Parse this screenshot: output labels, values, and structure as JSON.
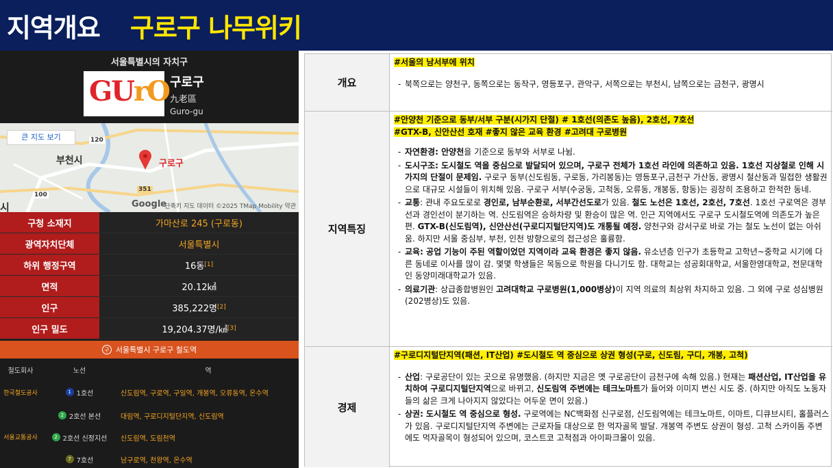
{
  "header": {
    "title_white": "지역개요",
    "title_yellow": "구로구 나무위키"
  },
  "wiki": {
    "caption": "서울특별시의 자치구",
    "emblem_gu": "GU",
    "emblem_ro": "rO",
    "name_ko": "구로구",
    "name_hanja": "九老區",
    "name_en": "Guro-gu",
    "map": {
      "button": "큰 지도 보기",
      "label_bucheon": "부천시",
      "label_guro": "구로구",
      "road_120": "120",
      "road_100": "100",
      "road_351": "351",
      "google": "Google",
      "credit": "단축키   지도 데이터 ©2025 TMap Mobility   약관",
      "label_edge": "시"
    },
    "info_rows": [
      {
        "key": "구청 소재지",
        "value": "가마산로 245 (구로동)",
        "sup": ""
      },
      {
        "key": "광역자치단체",
        "value": "서울특별시",
        "sup": ""
      },
      {
        "key": "하위 행정구역",
        "value": "16동",
        "sup": "[1]"
      },
      {
        "key": "면적",
        "value": "20.12㎢",
        "sup": ""
      },
      {
        "key": "인구",
        "value": "385,222명",
        "sup": "[2]"
      },
      {
        "key": "인구 밀도",
        "value": "19,204.37명/㎢",
        "sup": "[3]"
      }
    ],
    "rail": {
      "title": "서울특별시 구로구 철도역",
      "logo": "구",
      "cols": [
        "철도회사",
        "노선",
        "역"
      ],
      "operators": [
        "한국철도공사",
        "서울교통공사"
      ],
      "rows": [
        {
          "num": "1",
          "color": "#1a3fa0",
          "line": "1호선",
          "stations": "신도림역, 구로역, 구일역, 개봉역, 오류동역, 온수역"
        },
        {
          "num": "2",
          "color": "#2ea84a",
          "line": "2호선 본선",
          "stations": "대림역, 구로디지털단지역, 신도림역"
        },
        {
          "num": "2",
          "color": "#2ea84a",
          "line": "2호선 신정지선",
          "stations": "신도림역, 도림천역"
        },
        {
          "num": "7",
          "color": "#6b6b1f",
          "line": "7호선",
          "stations": "남구로역, 천왕역, 온수역"
        }
      ]
    }
  },
  "table": {
    "overview": {
      "key": "개요",
      "tag": "#서울의 남서부에 위치",
      "bullet": "북쪽으로는 양천구, 동쪽으로는 동작구, 영등포구, 관악구, 서쪽으로는 부천시, 남쪽으로는 금천구, 광명시"
    },
    "features": {
      "key": "지역특징",
      "tag1": "#안양천 기준으로 동부/서부 구분(시가지 단절) # 1호선(의존도 높음), 2호선, 7호선",
      "tag2": "#GTX-B, 신안산선 호재 #좋지 않은 교육 환경 #고려대 구로병원",
      "b1_bold": "자연환경: 안양천",
      "b1_rest": "을 기준으로 동부와 서부로 나뉨.",
      "b2_bold": "도시구조: 도시철도 역을 중심으로 발달되어 있으며, 구로구 전체가 1호선 라인에 의존하고 있음. 1호선 지상철로 인해 시가지의 단절이 문제임.",
      "b2_rest": " 구로구 동부(신도림동, 구로동, 가리봉동)는 영등포구,금천구 가산동, 광명시 철산동과 밀접한 생활권으로 대규모 시설들이 위치해 있음. 구로구 서부(수궁동, 고척동, 오류동, 개봉동, 항동)는 굉장히 조용하고 한적한 동네.",
      "b3_a": "교통",
      "b3_b": ": 관내 주요도로로 ",
      "b3_c": "경인로, 남부순환로, 서부간선도로",
      "b3_d": "가 있음. ",
      "b3_e": "철도 노선은 1호선, 2호선, 7호선",
      "b3_f": ". 1호선 구로역은 경부선과 경인선이 분기하는 역. 신도림역은 승하차량 및 환승이 많은 역. 인근 지역에서도 구로구 도시철도역에 의존도가 높은 편. ",
      "b3_g": "GTX-B(신도림역), 신안산선(구로디지털단지역)도 개통될 예정.",
      "b3_h": " 양천구와 강서구로 바로 가는 철도 노선이 없는 아쉬움. 하지만 서울 중심부, 부천, 인천 방향으로의 접근성은 훌륭함.",
      "b4_bold": "교육: 공업 기능이 주된 역할이었던 지역이라 교육 환경은 좋지 않음.",
      "b4_rest": " 유소년층 인구가 초등학교 고학년~중학교 시기에 다른 동네로 이사를 많이 감. 몇몇 학생들은 목동으로 학원을 다니기도 함. 대학교는 성공회대학교, 서울한영대학교, 전문대학인 동양미래대학교가 있음.",
      "b5_a": "의료기관",
      "b5_b": ": 상급종합병원인 ",
      "b5_c": "고려대학교 구로병원(1,000병상)",
      "b5_d": "이 지역 의료의 최상위 차지하고 있음. 그 외에 구로 성심병원(202병상)도 있음."
    },
    "economy": {
      "key": "경제",
      "tag": "#구로디지털단지역(패션, IT산업) #도시철도 역 중심으로 상권 형성(구로, 신도림, 구디, 개봉, 고척)",
      "b1_a": "산업",
      "b1_b": ": 구로공단이 있는 곳으로 유명했음. (하지만 지금은 옛 구로공단이 금천구에 속해 있음.) 현재는 ",
      "b1_c": "패션산업, IT산업을 유치하여 구로디지털단지역",
      "b1_d": "으로 바뀌고, ",
      "b1_e": "신도림역 주변에는 테크노마트",
      "b1_f": "가 들어와 이미지 변신 시도 중. (하지만 아직도 노동자들의 삶은 크게 나아지지 않았다는 어두운 면이 있음.)",
      "b2_a": "상권: 도시철도 역 중심으로 형성.",
      "b2_b": " 구로역에는 NC백화점 신구로점, 신도림역에는 테크노마트, 이마트, 디큐브시티, 홀플러스가 있음. 구로디지털단지역 주변에는 근로자들 대상으로 한 먹자골목 발달. 개봉역 주변도 상권이 형성. 고척 스카이돔 주변에도 먹자골목이 형성되어 있으며, 코스트코 고척점과 아이파크몰이 있음."
    }
  }
}
